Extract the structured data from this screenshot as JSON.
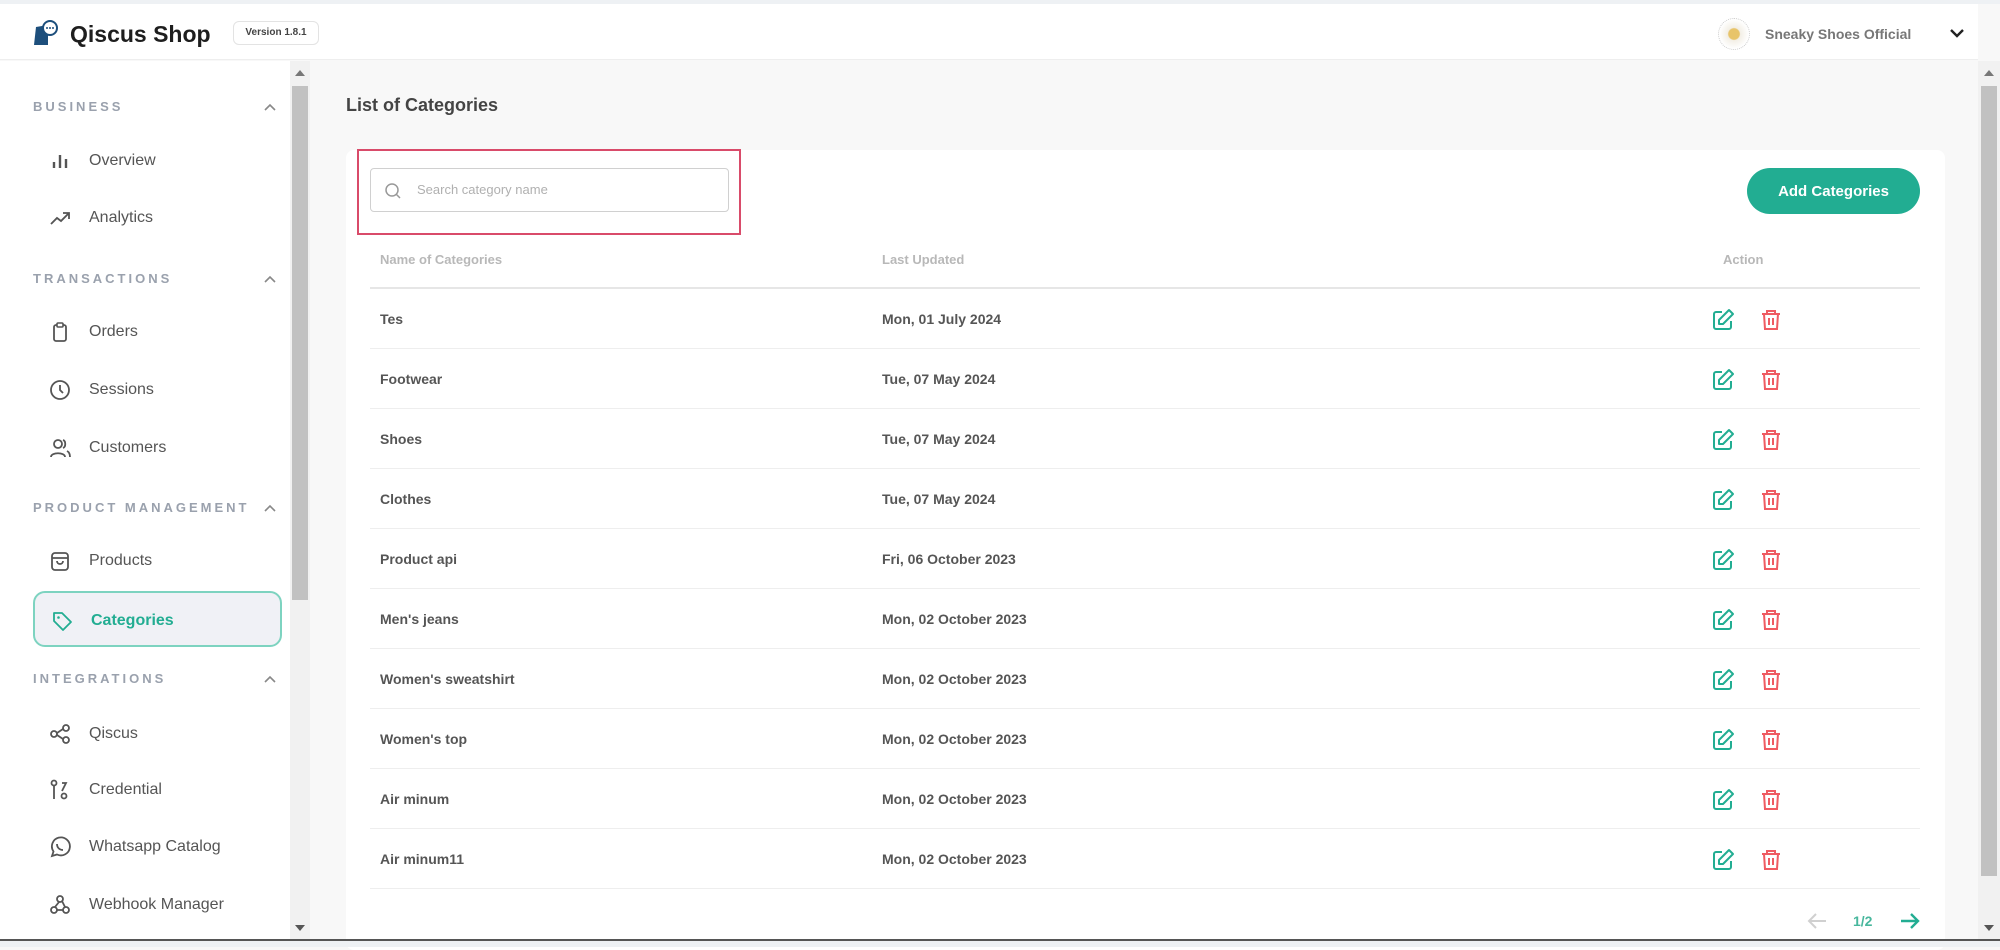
{
  "header": {
    "brand": "Qiscus Shop",
    "version": "Version 1.8.1",
    "user_name": "Sneaky Shoes Official"
  },
  "sidebar": {
    "sections": [
      {
        "title": "BUSINESS",
        "items": [
          {
            "label": "Overview",
            "icon": "bar-chart-icon"
          },
          {
            "label": "Analytics",
            "icon": "trending-up-icon"
          }
        ]
      },
      {
        "title": "TRANSACTIONS",
        "items": [
          {
            "label": "Orders",
            "icon": "clipboard-icon"
          },
          {
            "label": "Sessions",
            "icon": "clock-icon"
          },
          {
            "label": "Customers",
            "icon": "users-icon"
          }
        ]
      },
      {
        "title": "PRODUCT MANAGEMENT",
        "items": [
          {
            "label": "Products",
            "icon": "shopping-bag-icon"
          },
          {
            "label": "Categories",
            "icon": "tag-icon",
            "active": true
          }
        ]
      },
      {
        "title": "INTEGRATIONS",
        "items": [
          {
            "label": "Qiscus",
            "icon": "share-icon"
          },
          {
            "label": "Credential",
            "icon": "key-path-icon"
          },
          {
            "label": "Whatsapp Catalog",
            "icon": "whatsapp-icon"
          },
          {
            "label": "Webhook Manager",
            "icon": "webhook-icon"
          }
        ]
      }
    ]
  },
  "main": {
    "title": "List of Categories",
    "search_placeholder": "Search category name",
    "search_value": "",
    "add_button": "Add Categories",
    "columns": [
      "Name of Categories",
      "Last Updated",
      "Action"
    ],
    "rows": [
      {
        "name": "Tes",
        "updated": "Mon, 01 July 2024"
      },
      {
        "name": "Footwear",
        "updated": "Tue, 07 May 2024"
      },
      {
        "name": "Shoes",
        "updated": "Tue, 07 May 2024"
      },
      {
        "name": "Clothes",
        "updated": "Tue, 07 May 2024"
      },
      {
        "name": "Product api",
        "updated": "Fri, 06 October 2023"
      },
      {
        "name": "Men's jeans",
        "updated": "Mon, 02 October 2023"
      },
      {
        "name": "Women's sweatshirt",
        "updated": "Mon, 02 October 2023"
      },
      {
        "name": "Women's top",
        "updated": "Mon, 02 October 2023"
      },
      {
        "name": "Air minum",
        "updated": "Mon, 02 October 2023"
      },
      {
        "name": "Air minum11",
        "updated": "Mon, 02 October 2023"
      }
    ],
    "pagination": "1/2"
  },
  "colors": {
    "accent": "#22ad92",
    "danger": "#ef5b62",
    "highlight": "#d94b6a"
  }
}
